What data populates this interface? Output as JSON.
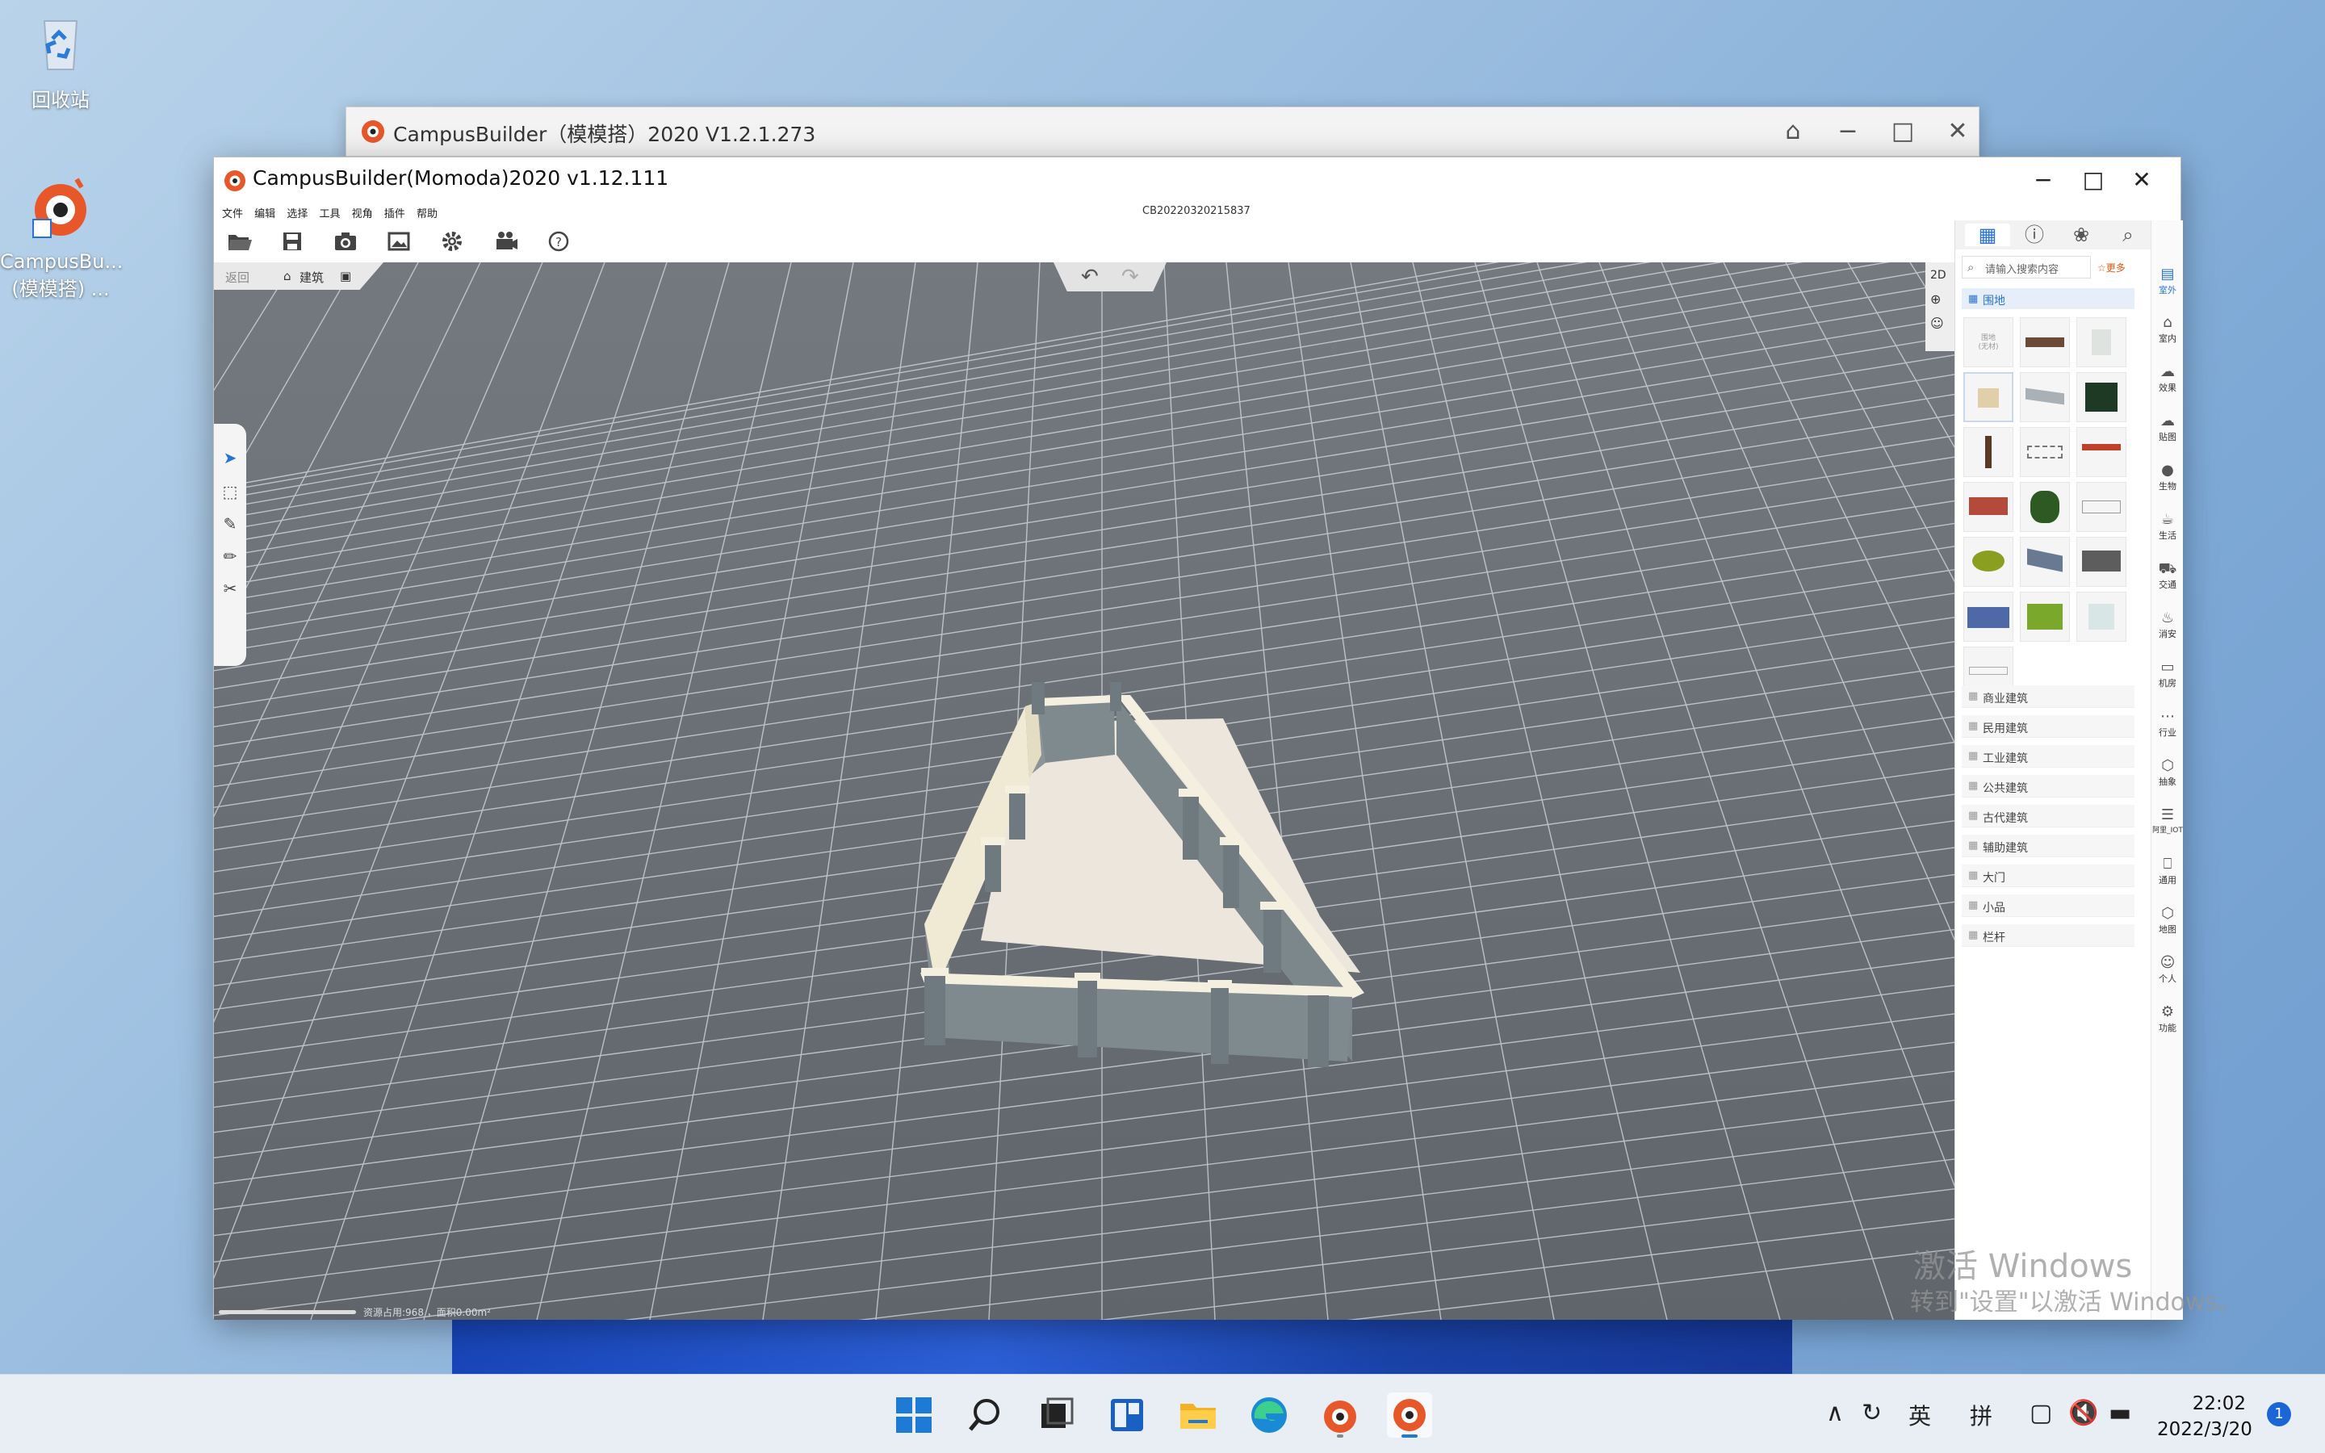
{
  "desktop": {
    "recycle_bin_label": "回收站",
    "app_shortcut_label_1": "CampusBu...",
    "app_shortcut_label_2": "(模模搭) ..."
  },
  "back_window": {
    "title": "CampusBuilder（模模搭）2020  V1.2.1.273",
    "controls": [
      "shirt-icon",
      "minimize",
      "maximize",
      "close"
    ]
  },
  "main_window": {
    "title": "CampusBuilder(Momoda)2020 v1.12.111",
    "menu": [
      "文件",
      "编辑",
      "选择",
      "工具",
      "视角",
      "插件",
      "帮助"
    ],
    "serial": "CB20220320215837",
    "toolbar_icons": [
      "open-folder-icon",
      "save-icon",
      "camera-icon",
      "image-icon",
      "gear-icon",
      "video-icon",
      "help-icon"
    ],
    "breadcrumb": {
      "back": "返回",
      "current": "建筑"
    },
    "view_mode": "2D",
    "status": "资源占用:968 ，面积0.00m²"
  },
  "panel": {
    "tabs": [
      "grid-icon",
      "info-icon",
      "palette-icon",
      "search-icon"
    ],
    "search_placeholder": "请输入搜索内容",
    "more_label": "更多",
    "active_category": "围地",
    "first_cell_text": "围地\n(无材)",
    "categories": [
      "商业建筑",
      "民用建筑",
      "工业建筑",
      "公共建筑",
      "古代建筑",
      "辅助建筑",
      "大门",
      "小品",
      "栏杆"
    ],
    "side_nav": [
      "室外",
      "室内",
      "效果",
      "贴图",
      "生物",
      "生活",
      "交通",
      "消安",
      "机房",
      "行业",
      "抽象",
      "阿里_IOT",
      "通用",
      "地图",
      "个人",
      "功能"
    ]
  },
  "watermark": {
    "line1": "激活 Windows",
    "line2": "转到\"设置\"以激活 Windows。"
  },
  "taskbar": {
    "ime_1": "英",
    "ime_2": "拼",
    "time": "22:02",
    "date": "2022/3/20",
    "notification_count": "1"
  },
  "colors": {
    "accent": "#2a73d6",
    "ground": "#6d737a",
    "wall": "#7f8a8f",
    "wall_top": "#f4efdf"
  }
}
